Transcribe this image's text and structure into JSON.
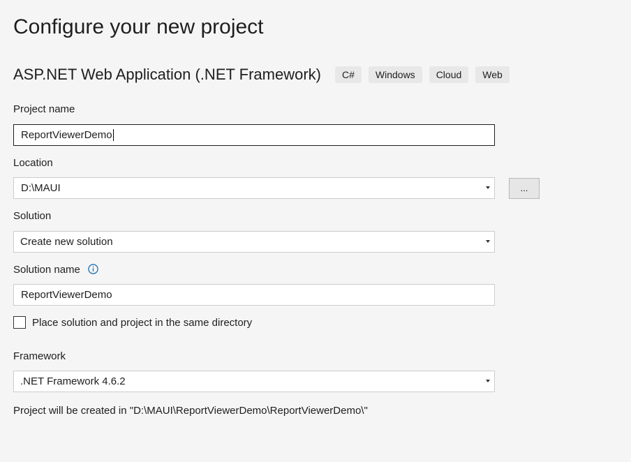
{
  "title": "Configure your new project",
  "template": {
    "name": "ASP.NET Web Application (.NET Framework)",
    "tags": [
      "C#",
      "Windows",
      "Cloud",
      "Web"
    ]
  },
  "project_name": {
    "label": "Project name",
    "value": "ReportViewerDemo"
  },
  "location": {
    "label": "Location",
    "value": "D:\\MAUI",
    "browse_label": "..."
  },
  "solution": {
    "label": "Solution",
    "value": "Create new solution"
  },
  "solution_name": {
    "label": "Solution name",
    "value": "ReportViewerDemo",
    "info_icon": "info-icon"
  },
  "same_directory": {
    "label": "Place solution and project in the same directory",
    "checked": false
  },
  "framework": {
    "label": "Framework",
    "value": ".NET Framework 4.6.2"
  },
  "summary": "Project will be created in \"D:\\MAUI\\ReportViewerDemo\\ReportViewerDemo\\\"",
  "colors": {
    "background": "#f5f5f5",
    "info_icon": "#1a72b8"
  }
}
